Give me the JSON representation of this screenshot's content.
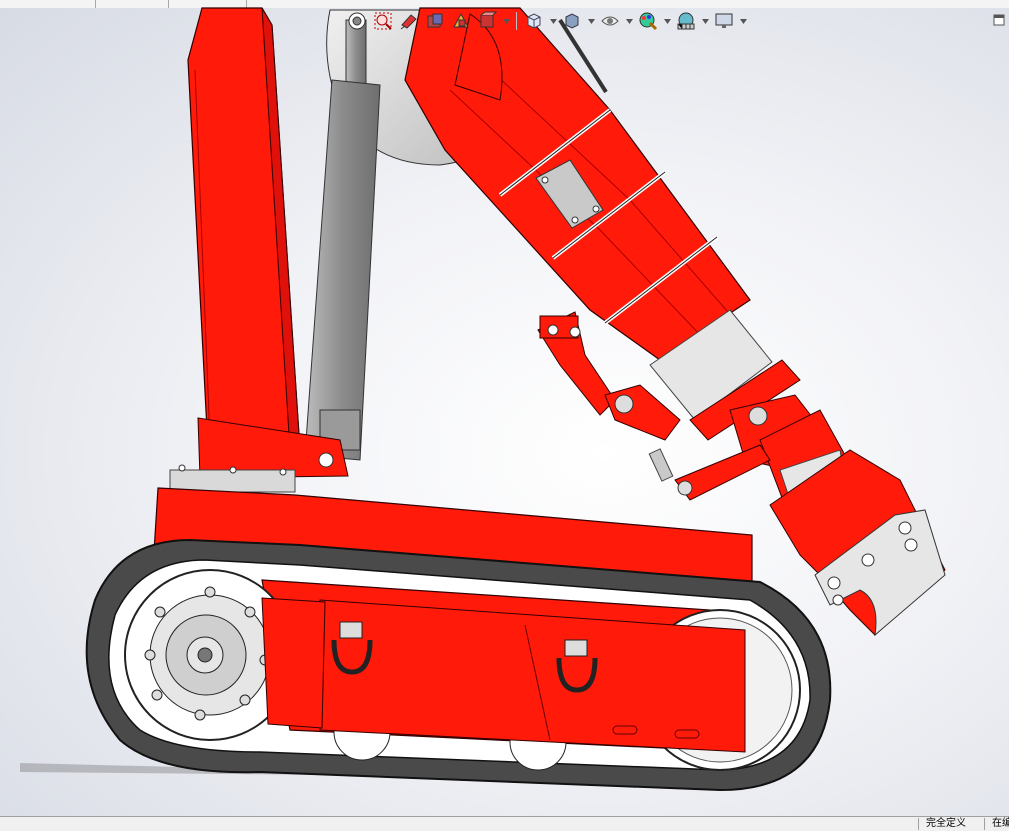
{
  "window": {
    "title": ""
  },
  "hud_toolbar": {
    "buttons": [
      {
        "name": "zoom-to-fit",
        "icon": "zoom-to-fit-icon"
      },
      {
        "name": "zoom-to-area",
        "icon": "zoom-to-area-icon"
      },
      {
        "name": "previous-view",
        "icon": "previous-view-icon"
      },
      {
        "name": "section-view",
        "icon": "section-view-icon"
      },
      {
        "name": "dynamic-annotation-views",
        "icon": "annotation-view-icon"
      },
      {
        "name": "3d-view",
        "icon": "3d-view-icon"
      },
      {
        "name": "view-orientation",
        "icon": "view-orientation-cube-icon"
      },
      {
        "name": "display-style",
        "icon": "display-style-icon"
      },
      {
        "name": "hide-show-items",
        "icon": "hide-show-eye-icon"
      },
      {
        "name": "edit-appearance",
        "icon": "edit-appearance-icon"
      },
      {
        "name": "apply-scene",
        "icon": "apply-scene-icon"
      },
      {
        "name": "view-settings",
        "icon": "monitor-icon"
      }
    ]
  },
  "colors": {
    "body_red": "#ff1a0a",
    "edge_dark": "#5a0000",
    "track_dark": "#4a4a4a",
    "steel_gray": "#9a9a9a",
    "sprocket_light": "#e6e6e6"
  },
  "status_bar": {
    "status": "完全定义",
    "next": "在编"
  }
}
